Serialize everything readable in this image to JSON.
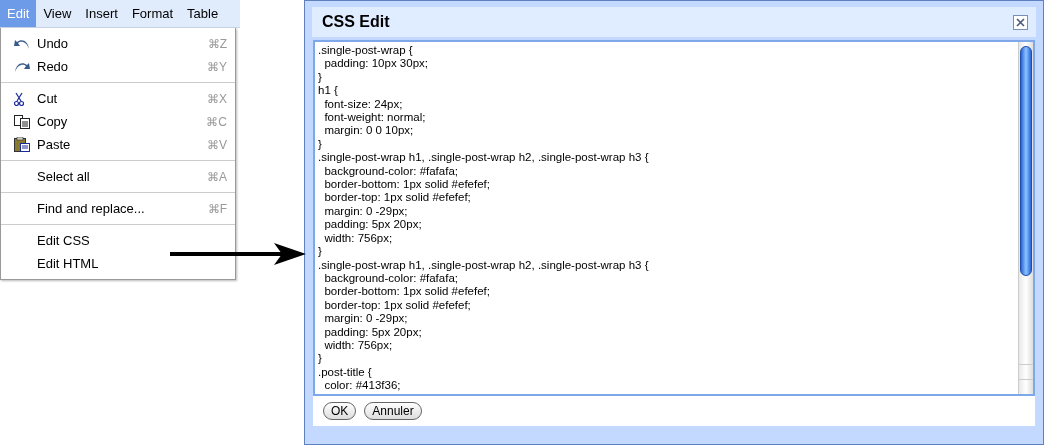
{
  "menubar": [
    {
      "label": "Edit",
      "selected": true
    },
    {
      "label": "View",
      "selected": false
    },
    {
      "label": "Insert",
      "selected": false
    },
    {
      "label": "Format",
      "selected": false
    },
    {
      "label": "Table",
      "selected": false
    }
  ],
  "menu": {
    "groups": [
      [
        {
          "kind": "undo",
          "label": "Undo",
          "shortcut": "⌘Z"
        },
        {
          "kind": "redo",
          "label": "Redo",
          "shortcut": "⌘Y"
        }
      ],
      [
        {
          "kind": "cut",
          "label": "Cut",
          "shortcut": "⌘X"
        },
        {
          "kind": "copy",
          "label": "Copy",
          "shortcut": "⌘C"
        },
        {
          "kind": "paste",
          "label": "Paste",
          "shortcut": "⌘V"
        }
      ],
      [
        {
          "kind": "plain",
          "label": "Select all",
          "shortcut": "⌘A"
        }
      ],
      [
        {
          "kind": "plain",
          "label": "Find and replace...",
          "shortcut": "⌘F"
        }
      ],
      [
        {
          "kind": "plain",
          "label": "Edit CSS"
        },
        {
          "kind": "plain",
          "label": "Edit HTML"
        }
      ]
    ]
  },
  "dialog": {
    "title": "CSS Edit",
    "code": [
      ".single-post-wrap {",
      "  padding: 10px 30px;",
      "}",
      "h1 {",
      "  font-size: 24px;",
      "  font-weight: normal;",
      "  margin: 0 0 10px;",
      "}",
      ".single-post-wrap h1, .single-post-wrap h2, .single-post-wrap h3 {",
      "  background-color: #fafafa;",
      "  border-bottom: 1px solid #efefef;",
      "  border-top: 1px solid #efefef;",
      "  margin: 0 -29px;",
      "  padding: 5px 20px;",
      "  width: 756px;",
      "}",
      ".single-post-wrap h1, .single-post-wrap h2, .single-post-wrap h3 {",
      "  background-color: #fafafa;",
      "  border-bottom: 1px solid #efefef;",
      "  border-top: 1px solid #efefef;",
      "  margin: 0 -29px;",
      "  padding: 5px 20px;",
      "  width: 756px;",
      "}",
      ".post-title {",
      "  color: #413f36;"
    ],
    "buttons": [
      "OK",
      "Annuler"
    ]
  }
}
